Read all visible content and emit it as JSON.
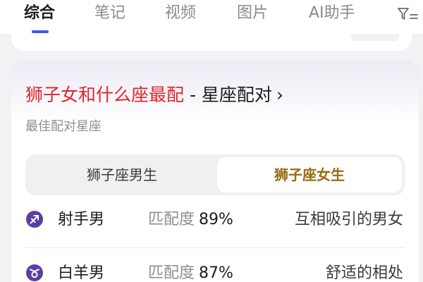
{
  "tabs": [
    {
      "label": "综合",
      "active": true
    },
    {
      "label": "笔记",
      "active": false
    },
    {
      "label": "视频",
      "active": false
    },
    {
      "label": "图片",
      "active": false
    },
    {
      "label": "AI助手",
      "active": false
    }
  ],
  "filter_icon": "filter-icon",
  "card": {
    "title_highlight": "狮子女和什么座最配",
    "title_rest": " - 星座配对",
    "title_chevron": "›",
    "subtitle": "最佳配对星座",
    "segments": [
      {
        "label": "狮子座男生",
        "active": false
      },
      {
        "label": "狮子座女生",
        "active": true
      }
    ],
    "rows": [
      {
        "icon": "sagittarius-icon",
        "name": "射手男",
        "score_label": "匹配度",
        "score": "89%",
        "desc": "互相吸引的男女"
      },
      {
        "icon": "aries-icon",
        "name": "白羊男",
        "score_label": "匹配度",
        "score": "87%",
        "desc": "舒适的相处"
      }
    ]
  },
  "colors": {
    "accent_blue": "#3b5cf0",
    "title_red": "#e0262d",
    "active_segment_text": "#9a6a10",
    "sign_icon_purple": "#5b3fa0"
  }
}
